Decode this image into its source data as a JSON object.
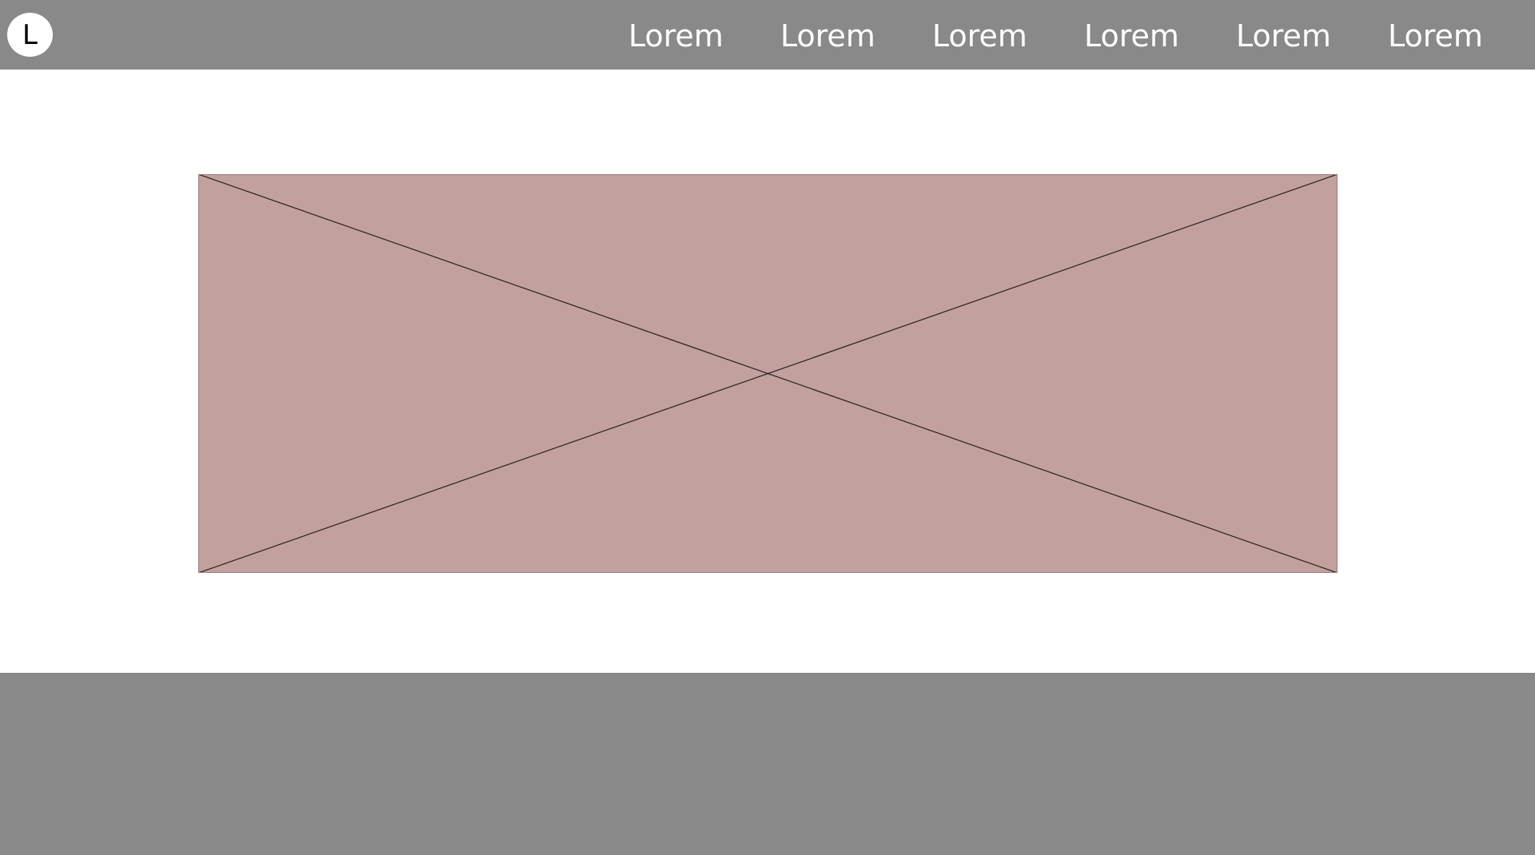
{
  "header": {
    "logo_letter": "L",
    "nav": [
      {
        "label": "Lorem"
      },
      {
        "label": "Lorem"
      },
      {
        "label": "Lorem"
      },
      {
        "label": "Lorem"
      },
      {
        "label": "Lorem"
      },
      {
        "label": "Lorem"
      }
    ]
  },
  "colors": {
    "header_bg": "#898989",
    "footer_bg": "#898989",
    "hero_bg": "#c1a09e",
    "text_on_header": "#ffffff"
  },
  "hero": {
    "image_placeholder_icon": "image-placeholder-icon"
  },
  "footer": {}
}
